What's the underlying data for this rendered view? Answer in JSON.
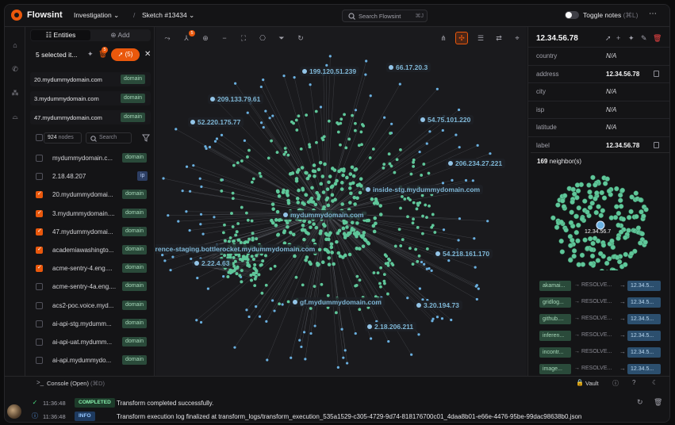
{
  "app": {
    "name": "Flowsint"
  },
  "topbar": {
    "investigation": "Investigation",
    "sketch": "Sketch #13434",
    "search_placeholder": "Search Flowsint",
    "search_shortcut": "⌘J",
    "toggle_notes": "Toggle notes",
    "toggle_notes_shortcut": "(⌘L)",
    "notes_enabled": false
  },
  "left": {
    "tabs": [
      "Entities",
      "Add"
    ],
    "selected_text": "5 selected it...",
    "action_badge": "5",
    "action_pill": "(5)",
    "selected_items": [
      {
        "name": "20.mydummydomain.com",
        "type": "domain"
      },
      {
        "name": "3.mydummydomain.com",
        "type": "domain"
      },
      {
        "name": "47.mydummydomain.com",
        "type": "domain"
      }
    ],
    "node_count": "924",
    "node_unit": "nodes",
    "search_placeholder": "Search",
    "rows": [
      {
        "name": "mydummydomain.c...",
        "type": "domain",
        "checked": false
      },
      {
        "name": "2.18.48.207",
        "type": "ip",
        "checked": false
      },
      {
        "name": "20.mydummydomai...",
        "type": "domain",
        "checked": true
      },
      {
        "name": "3.mydummydomain....",
        "type": "domain",
        "checked": true
      },
      {
        "name": "47.mydummydomai...",
        "type": "domain",
        "checked": true
      },
      {
        "name": "academiawashingto...",
        "type": "domain",
        "checked": true
      },
      {
        "name": "acme-sentry-4.eng....",
        "type": "domain",
        "checked": true
      },
      {
        "name": "acme-sentry-4a.eng....",
        "type": "domain",
        "checked": false
      },
      {
        "name": "acs2-poc.voice.myd...",
        "type": "domain",
        "checked": false
      },
      {
        "name": "ai-api-stg.mydumm...",
        "type": "domain",
        "checked": false
      },
      {
        "name": "ai-api-uat.mydumm...",
        "type": "domain",
        "checked": false
      },
      {
        "name": "ai-api.mydummydo...",
        "type": "domain",
        "checked": false
      }
    ]
  },
  "graph": {
    "toolbar_badge": "5",
    "labels": [
      {
        "text": "199.120.51.239"
      },
      {
        "text": "66.17.20.3"
      },
      {
        "text": "209.133.79.61"
      },
      {
        "text": "52.220.175.77"
      },
      {
        "text": "54.75.101.220"
      },
      {
        "text": "206.234.27.221"
      },
      {
        "text": "inside-stg.mydummydomain.com"
      },
      {
        "text": "mydummydomain.com"
      },
      {
        "text": "ference-staging.bottlerocket.mydummydomain.com"
      },
      {
        "text": "2.22.4.63"
      },
      {
        "text": "54.218.161.170"
      },
      {
        "text": "gf.mydummydomain.com"
      },
      {
        "text": "3.20.194.73"
      },
      {
        "text": "2.18.206.211"
      }
    ],
    "colors": {
      "node": "#5fc79a",
      "ip_node": "#6ab0e0",
      "edge": "#6b6f76"
    }
  },
  "right": {
    "title": "12.34.56.78",
    "properties": [
      {
        "key": "country",
        "value": "N/A",
        "na": true
      },
      {
        "key": "address",
        "value": "12.34.56.78",
        "na": false,
        "copy": true
      },
      {
        "key": "city",
        "value": "N/A",
        "na": true
      },
      {
        "key": "isp",
        "value": "N/A",
        "na": true
      },
      {
        "key": "latitude",
        "value": "N/A",
        "na": true
      },
      {
        "key": "label",
        "value": "12.34.56.78",
        "na": false,
        "copy": true
      }
    ],
    "neighbors_count": "169",
    "neighbors_label": "neighbor(s)",
    "center_label": "12.34.56.7",
    "relations": [
      {
        "from": "akamai...",
        "rel": "RESOLVE...",
        "to": "12.34.5..."
      },
      {
        "from": "gridlog...",
        "rel": "RESOLVE...",
        "to": "12.34.5..."
      },
      {
        "from": "github....",
        "rel": "RESOLVE...",
        "to": "12.34.5..."
      },
      {
        "from": "inferen...",
        "rel": "RESOLVE...",
        "to": "12.34.5..."
      },
      {
        "from": "incontr...",
        "rel": "RESOLVE...",
        "to": "12.34.5..."
      },
      {
        "from": "image...",
        "rel": "RESOLVE...",
        "to": "12.34.5..."
      }
    ]
  },
  "console": {
    "label": "Console (Open)",
    "shortcut": "(⌘D)",
    "vault": "Vault",
    "logs": [
      {
        "time": "11:36:48",
        "status": "COMPLETED",
        "message": "Transform completed successfully."
      },
      {
        "time": "11:36:48",
        "status": "INFO",
        "message": "Transform execution log finalized at transform_logs/transform_execution_535a1529-c305-4729-9d74-818176700c01_4daa8b01-e66e-4476-95be-99dac98638b0.json"
      }
    ]
  }
}
